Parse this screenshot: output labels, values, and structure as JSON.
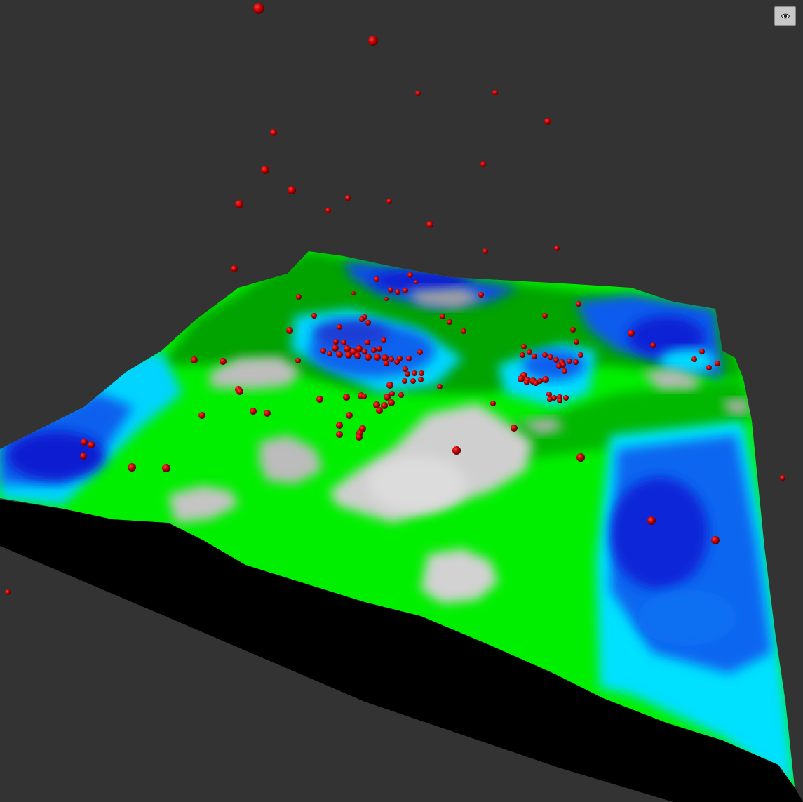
{
  "viewer": {
    "background_color": "#333333",
    "toolbar": {
      "view_toggle_icon": "eye-icon"
    }
  },
  "terrain": {
    "color_scale": {
      "deep_water": "#0018c8",
      "water": "#0a64f0",
      "shallow_water": "#00e6ff",
      "lowland": "#00ef00",
      "highland": "#04a004",
      "peak": "#c8c8c8",
      "base": "#000000"
    }
  },
  "markers": {
    "color": "#c00000",
    "shape": "sphere"
  }
}
